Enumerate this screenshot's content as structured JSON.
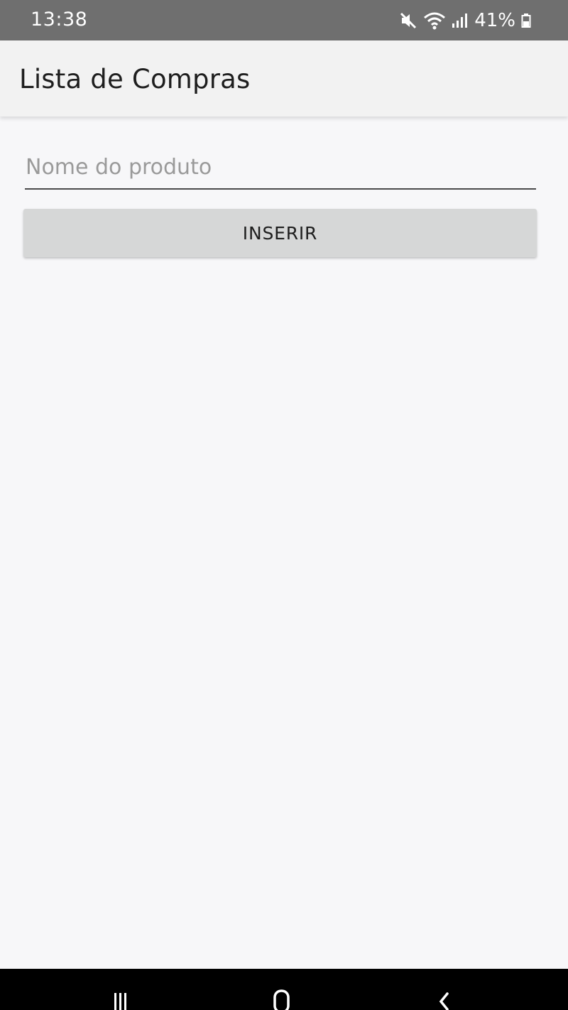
{
  "status_bar": {
    "time": "13:38",
    "battery": "41%",
    "icons": [
      "mute-icon",
      "wifi-icon",
      "signal-icon",
      "battery-icon"
    ]
  },
  "app_bar": {
    "title": "Lista de Compras"
  },
  "form": {
    "input_value": "",
    "input_placeholder": "Nome do produto",
    "button_label": "INSERIR"
  },
  "nav_bar": {
    "buttons": [
      "recents-icon",
      "home-icon",
      "back-icon"
    ]
  },
  "colors": {
    "status_bar": "#6f6f6f",
    "app_bar": "#f2f2f2",
    "background": "#f7f7f9",
    "button": "#d6d7d7",
    "nav_bar": "#000000"
  }
}
